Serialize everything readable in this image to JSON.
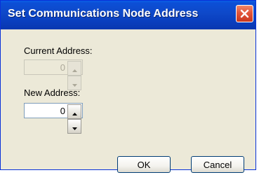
{
  "window": {
    "title": "Set Communications Node Address"
  },
  "fields": {
    "current": {
      "label": "Current Address:",
      "value": "0",
      "enabled": false
    },
    "new": {
      "label": "New Address:",
      "value": "0",
      "enabled": true
    }
  },
  "buttons": {
    "ok_label": "OK",
    "cancel_label": "Cancel"
  },
  "icons": {
    "close": "close-icon",
    "spin_up": "arrow-up-icon",
    "spin_down": "arrow-down-icon"
  },
  "colors": {
    "titlebar": "#0c4fd6",
    "close_button": "#e2553a",
    "dialog_background": "#ece9d8"
  }
}
